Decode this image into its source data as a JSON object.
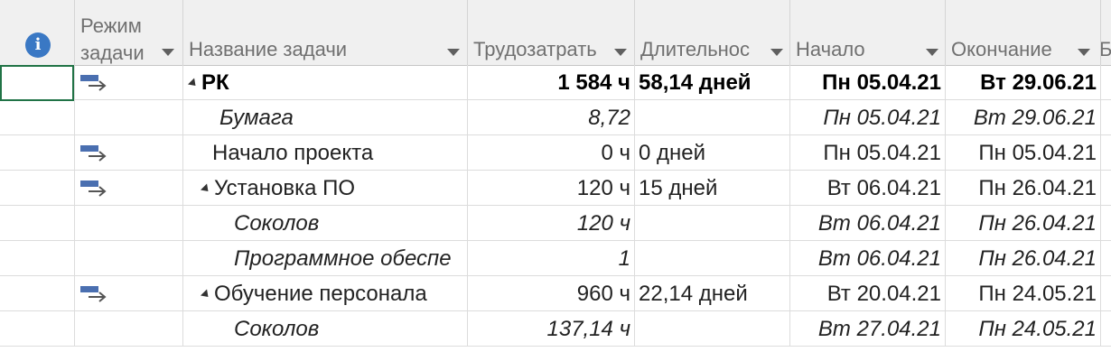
{
  "columns": {
    "mode": "Режим\nзадачи",
    "name": "Название задачи",
    "work": "Трудозатрать",
    "duration": "Длительнос",
    "start": "Начало",
    "finish": "Окончание",
    "extra": "Б"
  },
  "rows": [
    {
      "mode_icon": "auto-scheduled-task-icon",
      "name": "РК",
      "work": "1 584 ч",
      "duration": "58,14 дней",
      "start": "Пн 05.04.21",
      "finish": "Вт 29.06.21"
    },
    {
      "mode_icon": "",
      "name": "Бумага",
      "work": "8,72",
      "duration": "",
      "start": "Пн 05.04.21",
      "finish": "Вт 29.06.21"
    },
    {
      "mode_icon": "auto-scheduled-task-icon",
      "name": "Начало проекта",
      "work": "0 ч",
      "duration": "0 дней",
      "start": "Пн 05.04.21",
      "finish": "Пн 05.04.21"
    },
    {
      "mode_icon": "auto-scheduled-task-icon",
      "name": "Установка ПО",
      "work": "120 ч",
      "duration": "15 дней",
      "start": "Вт 06.04.21",
      "finish": "Пн 26.04.21"
    },
    {
      "mode_icon": "",
      "name": "Соколов",
      "work": "120 ч",
      "duration": "",
      "start": "Вт 06.04.21",
      "finish": "Пн 26.04.21"
    },
    {
      "mode_icon": "",
      "name": "Программное обеспе",
      "work": "1",
      "duration": "",
      "start": "Вт 06.04.21",
      "finish": "Пн 26.04.21"
    },
    {
      "mode_icon": "auto-scheduled-task-icon",
      "name": "Обучение персонала",
      "work": "960 ч",
      "duration": "22,14 дней",
      "start": "Вт 20.04.21",
      "finish": "Пн 24.05.21"
    },
    {
      "mode_icon": "",
      "name": "Соколов",
      "work": "137,14 ч",
      "duration": "",
      "start": "Вт 27.04.21",
      "finish": "Пн 24.05.21"
    }
  ]
}
